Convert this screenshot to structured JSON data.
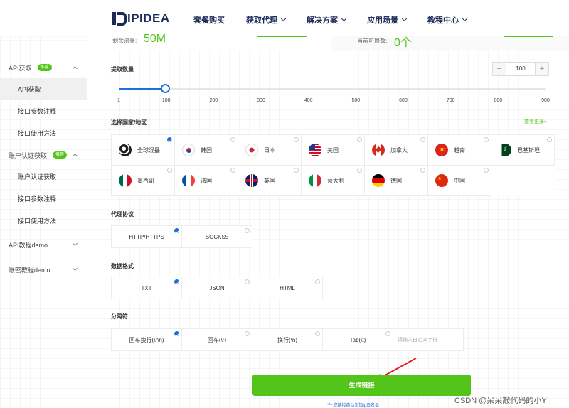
{
  "header": {
    "logo": "IPIDEA",
    "nav": [
      {
        "label": "套餐购买",
        "dropdown": false
      },
      {
        "label": "获取代理",
        "dropdown": true
      },
      {
        "label": "解决方案",
        "dropdown": true
      },
      {
        "label": "应用场景",
        "dropdown": true
      },
      {
        "label": "教程中心",
        "dropdown": true
      }
    ]
  },
  "top_cards": {
    "left_label": "剩余流量:",
    "left_value": "50M",
    "right_label": "当前可用数:",
    "right_value": "0个"
  },
  "sidebar": {
    "groups": [
      {
        "label": "API获取",
        "badge": "推荐",
        "expanded": true,
        "items": [
          {
            "label": "API获取",
            "active": true
          },
          {
            "label": "接口参数注释",
            "active": false
          },
          {
            "label": "接口使用方法",
            "active": false
          }
        ]
      },
      {
        "label": "账户认证获取",
        "badge": "推荐",
        "expanded": true,
        "items": [
          {
            "label": "账户认证获取",
            "active": false
          },
          {
            "label": "接口参数注释",
            "active": false
          },
          {
            "label": "接口使用方法",
            "active": false
          }
        ]
      },
      {
        "label": "API教程demo",
        "badge": "",
        "expanded": false,
        "items": []
      },
      {
        "label": "账密教程demo",
        "badge": "",
        "expanded": false,
        "items": []
      }
    ]
  },
  "extract": {
    "title": "提取数量",
    "value": "100",
    "minus": "−",
    "plus": "+",
    "slider": {
      "min": 1,
      "max": 900,
      "value": 100
    },
    "ticks": [
      "1",
      "100",
      "200",
      "300",
      "400",
      "500",
      "600",
      "700",
      "800",
      "900"
    ]
  },
  "region": {
    "title": "选择国家/地区",
    "see_more": "查看更多»",
    "items": [
      {
        "label": "全球混播",
        "icon": "globe-icon",
        "checked": true
      },
      {
        "label": "韩国",
        "icon": "korea-flag-icon",
        "checked": false
      },
      {
        "label": "日本",
        "icon": "japan-flag-icon",
        "checked": false
      },
      {
        "label": "美国",
        "icon": "usa-flag-icon",
        "checked": false
      },
      {
        "label": "加拿大",
        "icon": "canada-flag-icon",
        "checked": false
      },
      {
        "label": "越南",
        "icon": "vietnam-flag-icon",
        "checked": false
      },
      {
        "label": "巴基斯坦",
        "icon": "pakistan-flag-icon",
        "checked": false
      },
      {
        "label": "墨西哥",
        "icon": "mexico-flag-icon",
        "checked": false
      },
      {
        "label": "法国",
        "icon": "france-flag-icon",
        "checked": false
      },
      {
        "label": "英国",
        "icon": "uk-flag-icon",
        "checked": false
      },
      {
        "label": "意大利",
        "icon": "italy-flag-icon",
        "checked": false
      },
      {
        "label": "德国",
        "icon": "germany-flag-icon",
        "checked": false
      },
      {
        "label": "中国",
        "icon": "china-flag-icon",
        "checked": false
      }
    ]
  },
  "protocol": {
    "title": "代理协议",
    "items": [
      {
        "label": "HTTP/HTTPS",
        "checked": true
      },
      {
        "label": "SOCKS5",
        "checked": false
      }
    ]
  },
  "format": {
    "title": "数据格式",
    "items": [
      {
        "label": "TXT",
        "checked": true
      },
      {
        "label": "JSON",
        "checked": false
      },
      {
        "label": "HTML",
        "checked": false
      }
    ]
  },
  "separator": {
    "title": "分隔符",
    "items": [
      {
        "label": "回车换行(\\r\\n)",
        "checked": true
      },
      {
        "label": "回车(\\r)",
        "checked": false
      },
      {
        "label": "换行(\\n)",
        "checked": false
      },
      {
        "label": "Tab(\\t)",
        "checked": false
      }
    ],
    "custom_placeholder": "请输入自定义字符"
  },
  "generate_button": "生成链接",
  "hint": "*生成链接自动添加ip白名单",
  "watermark": "CSDN @呆呆敲代码的小Y",
  "colors": {
    "accent": "#52c41a",
    "primary": "#1e6fd9",
    "nav": "#1c2a5a"
  }
}
